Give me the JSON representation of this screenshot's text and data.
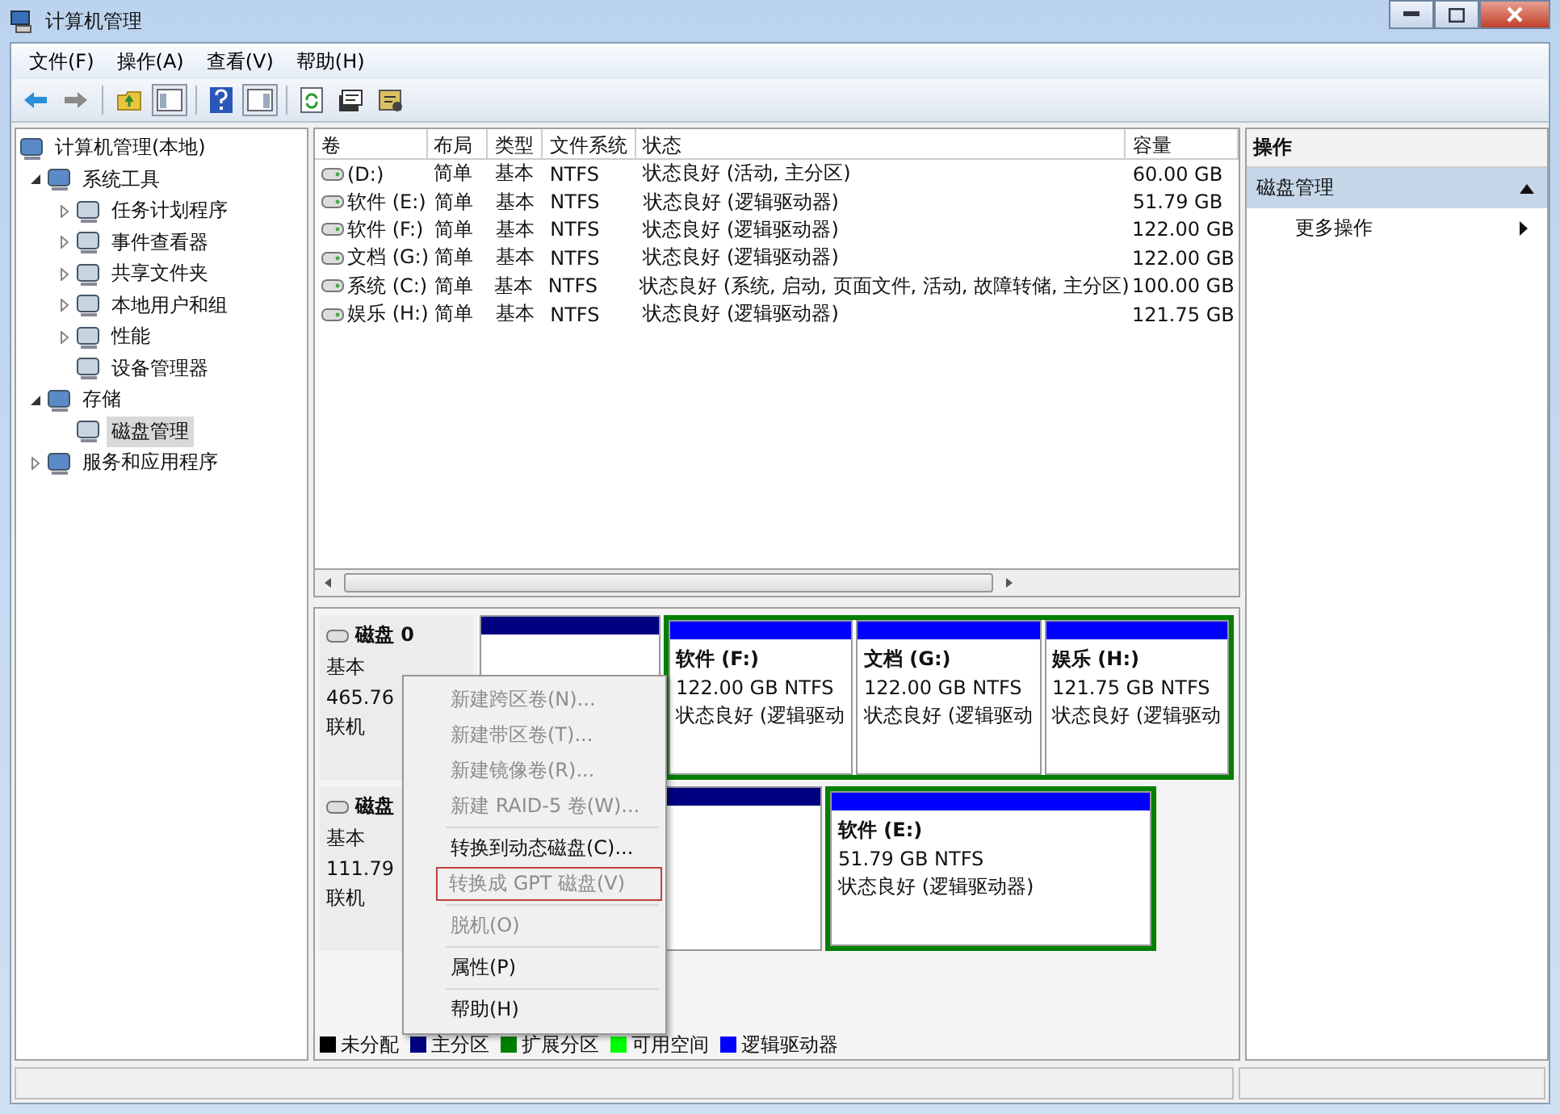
{
  "window": {
    "title": "计算机管理"
  },
  "menu_bar": [
    "文件(F)",
    "操作(A)",
    "查看(V)",
    "帮助(H)"
  ],
  "tree": [
    {
      "label": "计算机管理(本地)",
      "selected": false,
      "children": [
        {
          "label": "系统工具",
          "expanded": true,
          "selected": false,
          "children": [
            {
              "label": "任务计划程序",
              "expanded": false,
              "selected": false
            },
            {
              "label": "事件查看器",
              "expanded": false,
              "selected": false
            },
            {
              "label": "共享文件夹",
              "expanded": false,
              "selected": false
            },
            {
              "label": "本地用户和组",
              "expanded": false,
              "selected": false
            },
            {
              "label": "性能",
              "expanded": false,
              "selected": false
            },
            {
              "label": "设备管理器",
              "selected": false
            }
          ]
        },
        {
          "label": "存储",
          "expanded": true,
          "selected": false,
          "children": [
            {
              "label": "磁盘管理",
              "selected": true
            }
          ]
        },
        {
          "label": "服务和应用程序",
          "expanded": false,
          "selected": false
        }
      ]
    }
  ],
  "volumes": {
    "columns": [
      "卷",
      "布局",
      "类型",
      "文件系统",
      "状态",
      "容量"
    ],
    "rows": [
      [
        "(D:)",
        "简单",
        "基本",
        "NTFS",
        "状态良好 (活动, 主分区)",
        "60.00 GB"
      ],
      [
        "软件 (E:)",
        "简单",
        "基本",
        "NTFS",
        "状态良好 (逻辑驱动器)",
        "51.79 GB"
      ],
      [
        "软件 (F:)",
        "简单",
        "基本",
        "NTFS",
        "状态良好 (逻辑驱动器)",
        "122.00 GB"
      ],
      [
        "文档 (G:)",
        "简单",
        "基本",
        "NTFS",
        "状态良好 (逻辑驱动器)",
        "122.00 GB"
      ],
      [
        "系统 (C:)",
        "简单",
        "基本",
        "NTFS",
        "状态良好 (系统, 启动, 页面文件, 活动, 故障转储, 主分区)",
        "100.00 GB"
      ],
      [
        "娱乐 (H:)",
        "简单",
        "基本",
        "NTFS",
        "状态良好 (逻辑驱动器)",
        "121.75 GB"
      ]
    ]
  },
  "disks": [
    {
      "name": "磁盘 0",
      "type": "基本",
      "size": "465.76",
      "status": "联机",
      "partitions": [
        {
          "kind": "primary"
        },
        {
          "kind": "extended",
          "children": [
            {
              "name": "软件 (F:)",
              "size": "122.00 GB NTFS",
              "status": "状态良好 (逻辑驱动"
            },
            {
              "name": "文档 (G:)",
              "size": "122.00 GB NTFS",
              "status": "状态良好 (逻辑驱动"
            },
            {
              "name": "娱乐 (H:)",
              "size": "121.75 GB NTFS",
              "status": "状态良好 (逻辑驱动"
            }
          ]
        }
      ]
    },
    {
      "name": "磁盘",
      "type": "基本",
      "size": "111.79",
      "status": "联机",
      "partitions": [
        {
          "kind": "primary"
        },
        {
          "kind": "extended",
          "children": [
            {
              "name": "软件 (E:)",
              "size": "51.79 GB NTFS",
              "status": "状态良好 (逻辑驱动器)"
            }
          ]
        }
      ]
    }
  ],
  "legend": [
    {
      "label": "未分配",
      "color": "#000000"
    },
    {
      "label": "主分区",
      "color": "#000080"
    },
    {
      "label": "扩展分区",
      "color": "#008000"
    },
    {
      "label": "可用空间",
      "color": "#00ff00"
    },
    {
      "label": "逻辑驱动器",
      "color": "#0000ff"
    }
  ],
  "actions": {
    "title": "操作",
    "section": {
      "label": "磁盘管理",
      "expanded": true
    },
    "items": [
      {
        "label": "更多操作"
      }
    ]
  },
  "context_menu": [
    [
      {
        "label": "新建跨区卷(N)...",
        "disabled": true,
        "marked": false
      },
      {
        "label": "新建带区卷(T)...",
        "disabled": true,
        "marked": false
      },
      {
        "label": "新建镜像卷(R)...",
        "disabled": true,
        "marked": false
      },
      {
        "label": "新建 RAID-5 卷(W)...",
        "disabled": true,
        "marked": false
      }
    ],
    [
      {
        "label": "转换到动态磁盘(C)...",
        "disabled": false,
        "marked": false
      },
      {
        "label": "转换成 GPT 磁盘(V)",
        "disabled": true,
        "marked": true
      }
    ],
    [
      {
        "label": "脱机(O)",
        "disabled": true,
        "marked": false
      }
    ],
    [
      {
        "label": "属性(P)",
        "disabled": false,
        "marked": false
      }
    ],
    [
      {
        "label": "帮助(H)",
        "disabled": false,
        "marked": false
      }
    ]
  ]
}
